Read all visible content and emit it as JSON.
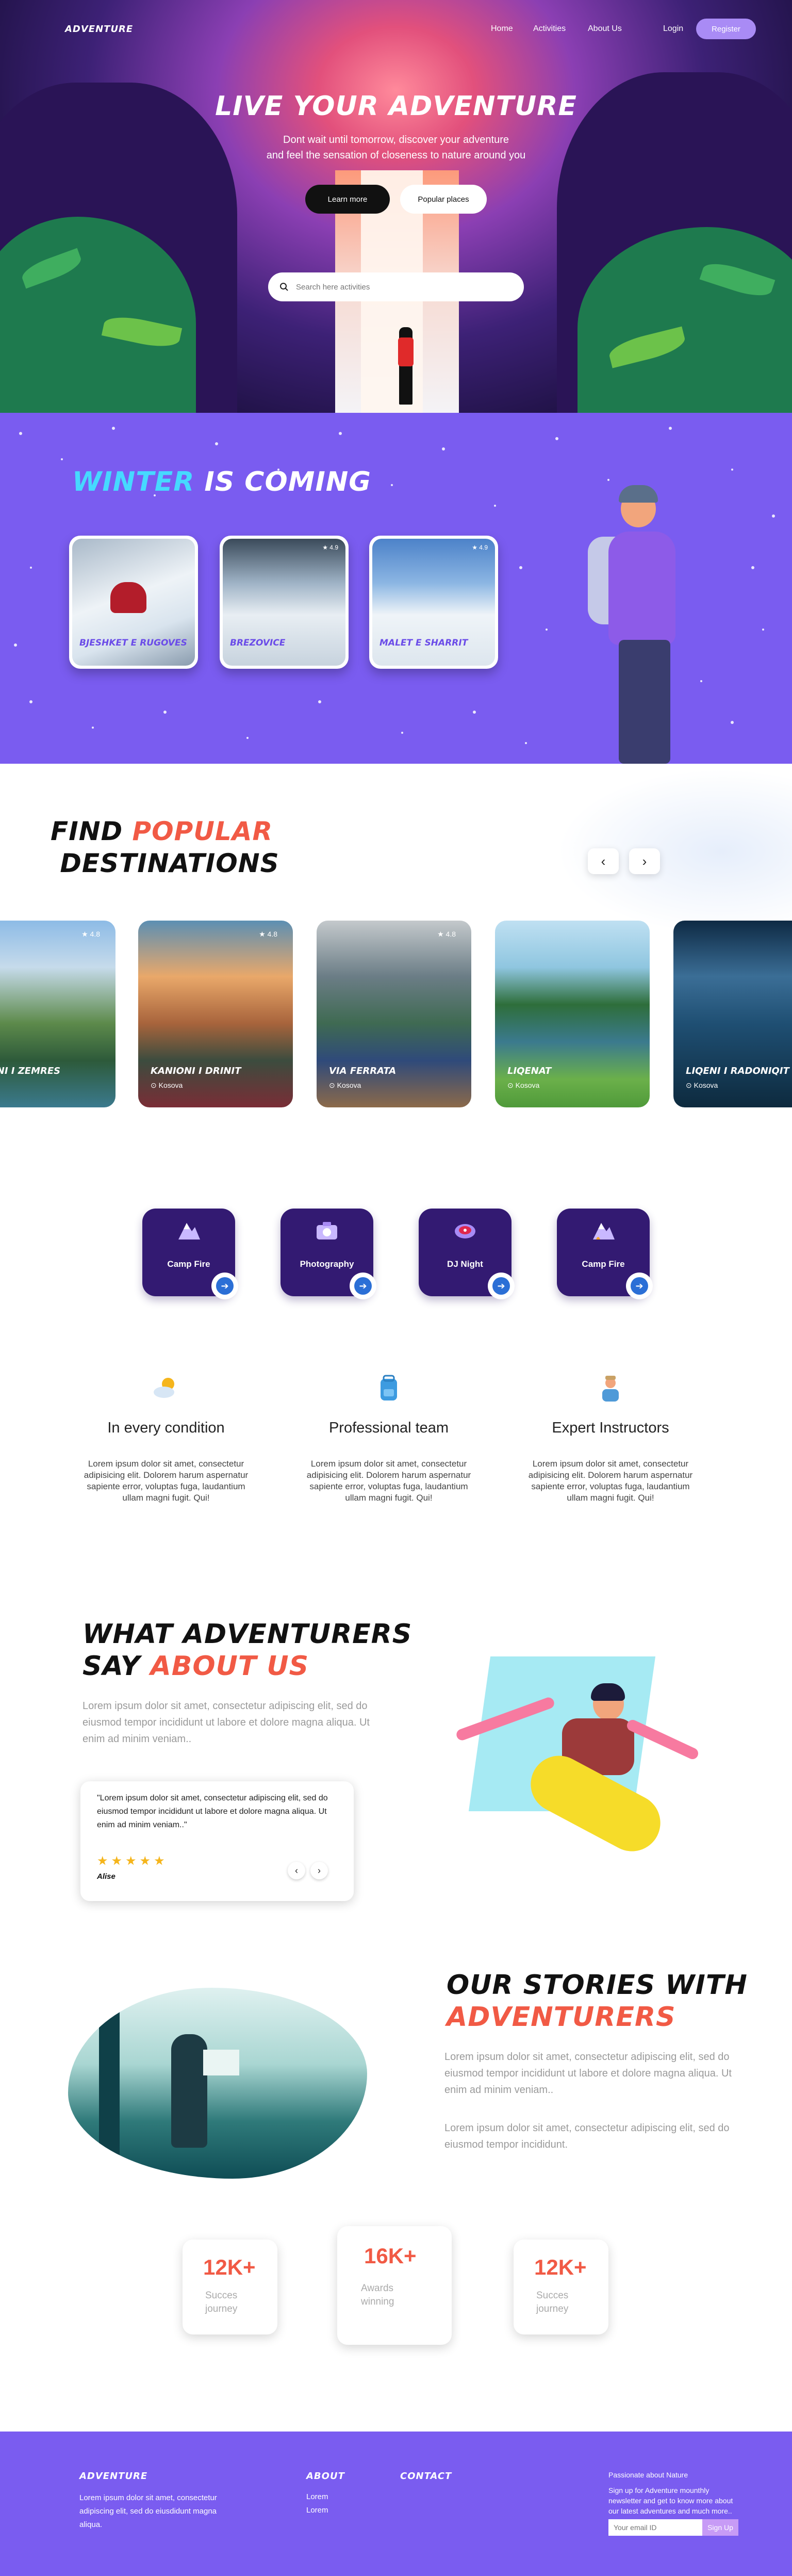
{
  "nav": {
    "logo": "ADVENTURE",
    "links": [
      "Home",
      "Activities",
      "About Us"
    ],
    "login": "Login",
    "register": "Register"
  },
  "hero": {
    "title": "LIVE YOUR ADVENTURE",
    "subtitle_line1": "Dont wait until tomorrow, discover your  adventure",
    "subtitle_line2": "and feel the sensation of closeness to nature around you",
    "learn_more": "Learn more",
    "popular_places": "Popular places",
    "search_placeholder": "Search here activities"
  },
  "winter": {
    "title_part1": "WINTER",
    "title_part2": "IS COMING",
    "cards": [
      {
        "name": "BJESHKET E RUGOVES",
        "rating": ""
      },
      {
        "name": "BREZOVICE",
        "rating": "★ 4.9"
      },
      {
        "name": "MALET E SHARRIT",
        "rating": "★ 4.9"
      }
    ]
  },
  "destinations": {
    "title_part1": "FIND",
    "title_part2": "POPULAR",
    "title_line2": "DESTINATIONS",
    "prev": "‹",
    "next": "›",
    "cards": [
      {
        "name": "LIQENI I ZEMRES",
        "location": "",
        "rating": "★ 4.8"
      },
      {
        "name": "KANIONI I DRINIT",
        "location": "Kosova",
        "rating": "★ 4.8"
      },
      {
        "name": "VIA FERRATA",
        "location": "Kosova",
        "rating": "★ 4.8"
      },
      {
        "name": "LIQENAT",
        "location": "Kosova",
        "rating": ""
      },
      {
        "name": "LIQENI I RADONIQIT",
        "location": "Kosova",
        "rating": ""
      }
    ]
  },
  "activities": [
    {
      "label": "Camp Fire"
    },
    {
      "label": "Photography"
    },
    {
      "label": "DJ Night"
    },
    {
      "label": "Camp Fire"
    }
  ],
  "features": [
    {
      "title": "In every condition",
      "text": "Lorem ipsum dolor sit amet, consectetur adipisicing elit. Dolorem harum aspernatur sapiente error, voluptas fuga, laudantium ullam magni fugit. Qui!"
    },
    {
      "title": "Professional team",
      "text": "Lorem ipsum dolor sit amet, consectetur adipisicing elit. Dolorem harum aspernatur sapiente error, voluptas fuga, laudantium ullam magni fugit. Qui!"
    },
    {
      "title": "Expert Instructors",
      "text": "Lorem ipsum dolor sit amet, consectetur adipisicing elit. Dolorem harum aspernatur sapiente error, voluptas fuga, laudantium ullam magni fugit. Qui!"
    }
  ],
  "testimonial": {
    "title_line1": "WHAT ADVENTURERS",
    "title_say": "SAY",
    "title_about": "ABOUT US",
    "body": "Lorem ipsum dolor sit amet, consectetur adipiscing elit, sed do eiusmod tempor incididunt ut labore et dolore magna aliqua. Ut enim ad minim veniam..",
    "quote": "\"Lorem ipsum dolor sit amet, consectetur adipiscing elit, sed do eiusmod tempor incididunt ut labore et dolore magna aliqua. Ut enim ad minim veniam..\"",
    "stars": "★★★★★",
    "author": "Alise",
    "prev": "‹",
    "next": "›"
  },
  "stories": {
    "title_line1": "OUR STORIES WITH",
    "title_line2": "ADVENTURERS",
    "para1": "Lorem ipsum dolor sit amet, consectetur adipiscing elit, sed do eiusmod tempor incididunt ut labore et dolore magna aliqua. Ut enim ad minim veniam..",
    "para2": "Lorem ipsum dolor sit amet, consectetur adipiscing elit, sed do eiusmod tempor incididunt."
  },
  "stats": [
    {
      "value": "12K+",
      "label": "Succes journey"
    },
    {
      "value": "16K+",
      "label": "Awards winning"
    },
    {
      "value": "12K+",
      "label": "Succes journey"
    }
  ],
  "footer": {
    "logo": "ADVENTURE",
    "text": "Lorem ipsum dolor sit amet, consectetur adipiscing elit, sed do eiusdidunt magna aliqua.",
    "about_heading": "ABOUT",
    "about_links": [
      "Lorem",
      "Lorem"
    ],
    "contact_heading": "CONTACT",
    "news_title": "Passionate about Nature",
    "news_desc": "Sign up for Adventure mounthly newsletter and get to know more about our latest adventures and much more..",
    "email_placeholder": "Your email ID",
    "signup": "Sign Up"
  },
  "colors": {
    "brand_purple": "#7a5cf0",
    "accent_red": "#f15a45",
    "winter_blue": "#46d9ff",
    "activity_card": "#331a72"
  }
}
